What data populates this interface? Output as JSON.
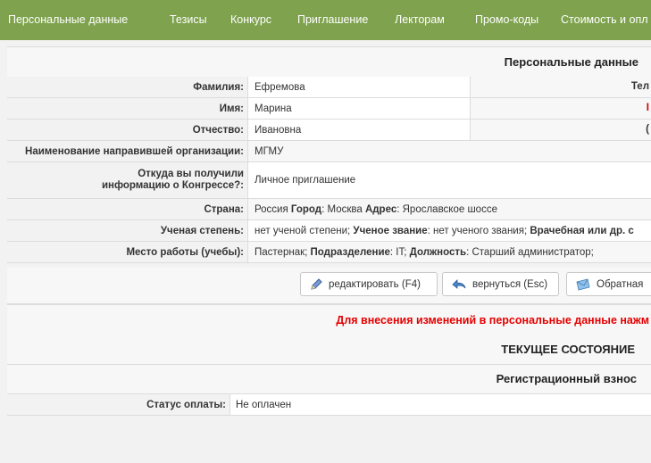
{
  "nav": {
    "items": [
      "Персональные данные",
      "Тезисы",
      "Конкурс",
      "Приглашение",
      "Лекторам",
      "Промо-коды",
      "Стоимость и опл"
    ]
  },
  "personal": {
    "section_title": "Персональные данные",
    "surname_label": "Фамилия:",
    "surname": "Ефремова",
    "name_label": "Имя:",
    "name": "Марина",
    "patronymic_label": "Отчество:",
    "patronymic": "Ивановна",
    "right_col_1": "Тел",
    "right_col_2": "I",
    "right_col_3": "(",
    "org_label": "Наименование направившей организации:",
    "org": "МГМУ",
    "source_label_line1": "Откуда вы получили",
    "source_label_line2": "информацию о Конгрессе?:",
    "source": "Личное приглашение",
    "country_label": "Страна:",
    "country": "Россия",
    "city_label": "Город",
    "city": "Москва",
    "address_label": "Адрес",
    "address": "Ярославское шоссе",
    "degree_label": "Ученая степень:",
    "degree": "нет ученой степени;",
    "title_label": "Ученое звание",
    "title_value": "нет ученого звания;",
    "position_label": "Врачебная или др. с",
    "work_label": "Место работы (учебы):",
    "work": "Пастернак;",
    "dept_label": "Подразделение",
    "dept": "IT;",
    "post_label": "Должность",
    "post": "Старший администратор;"
  },
  "buttons": {
    "edit": "редактировать (F4)",
    "back": "вернуться (Esc)",
    "feedback": "Обратная"
  },
  "notice": "Для внесения изменений в персональные данные нажм",
  "current_state": "ТЕКУЩЕЕ СОСТОЯНИЕ",
  "fee": {
    "section_title": "Регистрационный взнос",
    "status_label": "Статус оплаты:",
    "status": "Не оплачен"
  }
}
